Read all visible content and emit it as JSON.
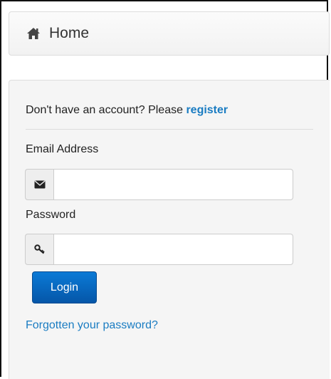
{
  "header": {
    "icon": "home-icon",
    "title": "Home"
  },
  "login_form": {
    "register_prompt": "Don't have an account? Please ",
    "register_link": "register",
    "email_label": "Email Address",
    "email_icon": "envelope-icon",
    "email_value": "",
    "password_label": "Password",
    "password_icon": "key-icon",
    "password_value": "",
    "login_label": "Login",
    "forgot_link": "Forgotten your password?"
  },
  "colors": {
    "link": "#1a7cc2",
    "button": "#0a6ac4",
    "panel_background": "#f5f5f5"
  }
}
